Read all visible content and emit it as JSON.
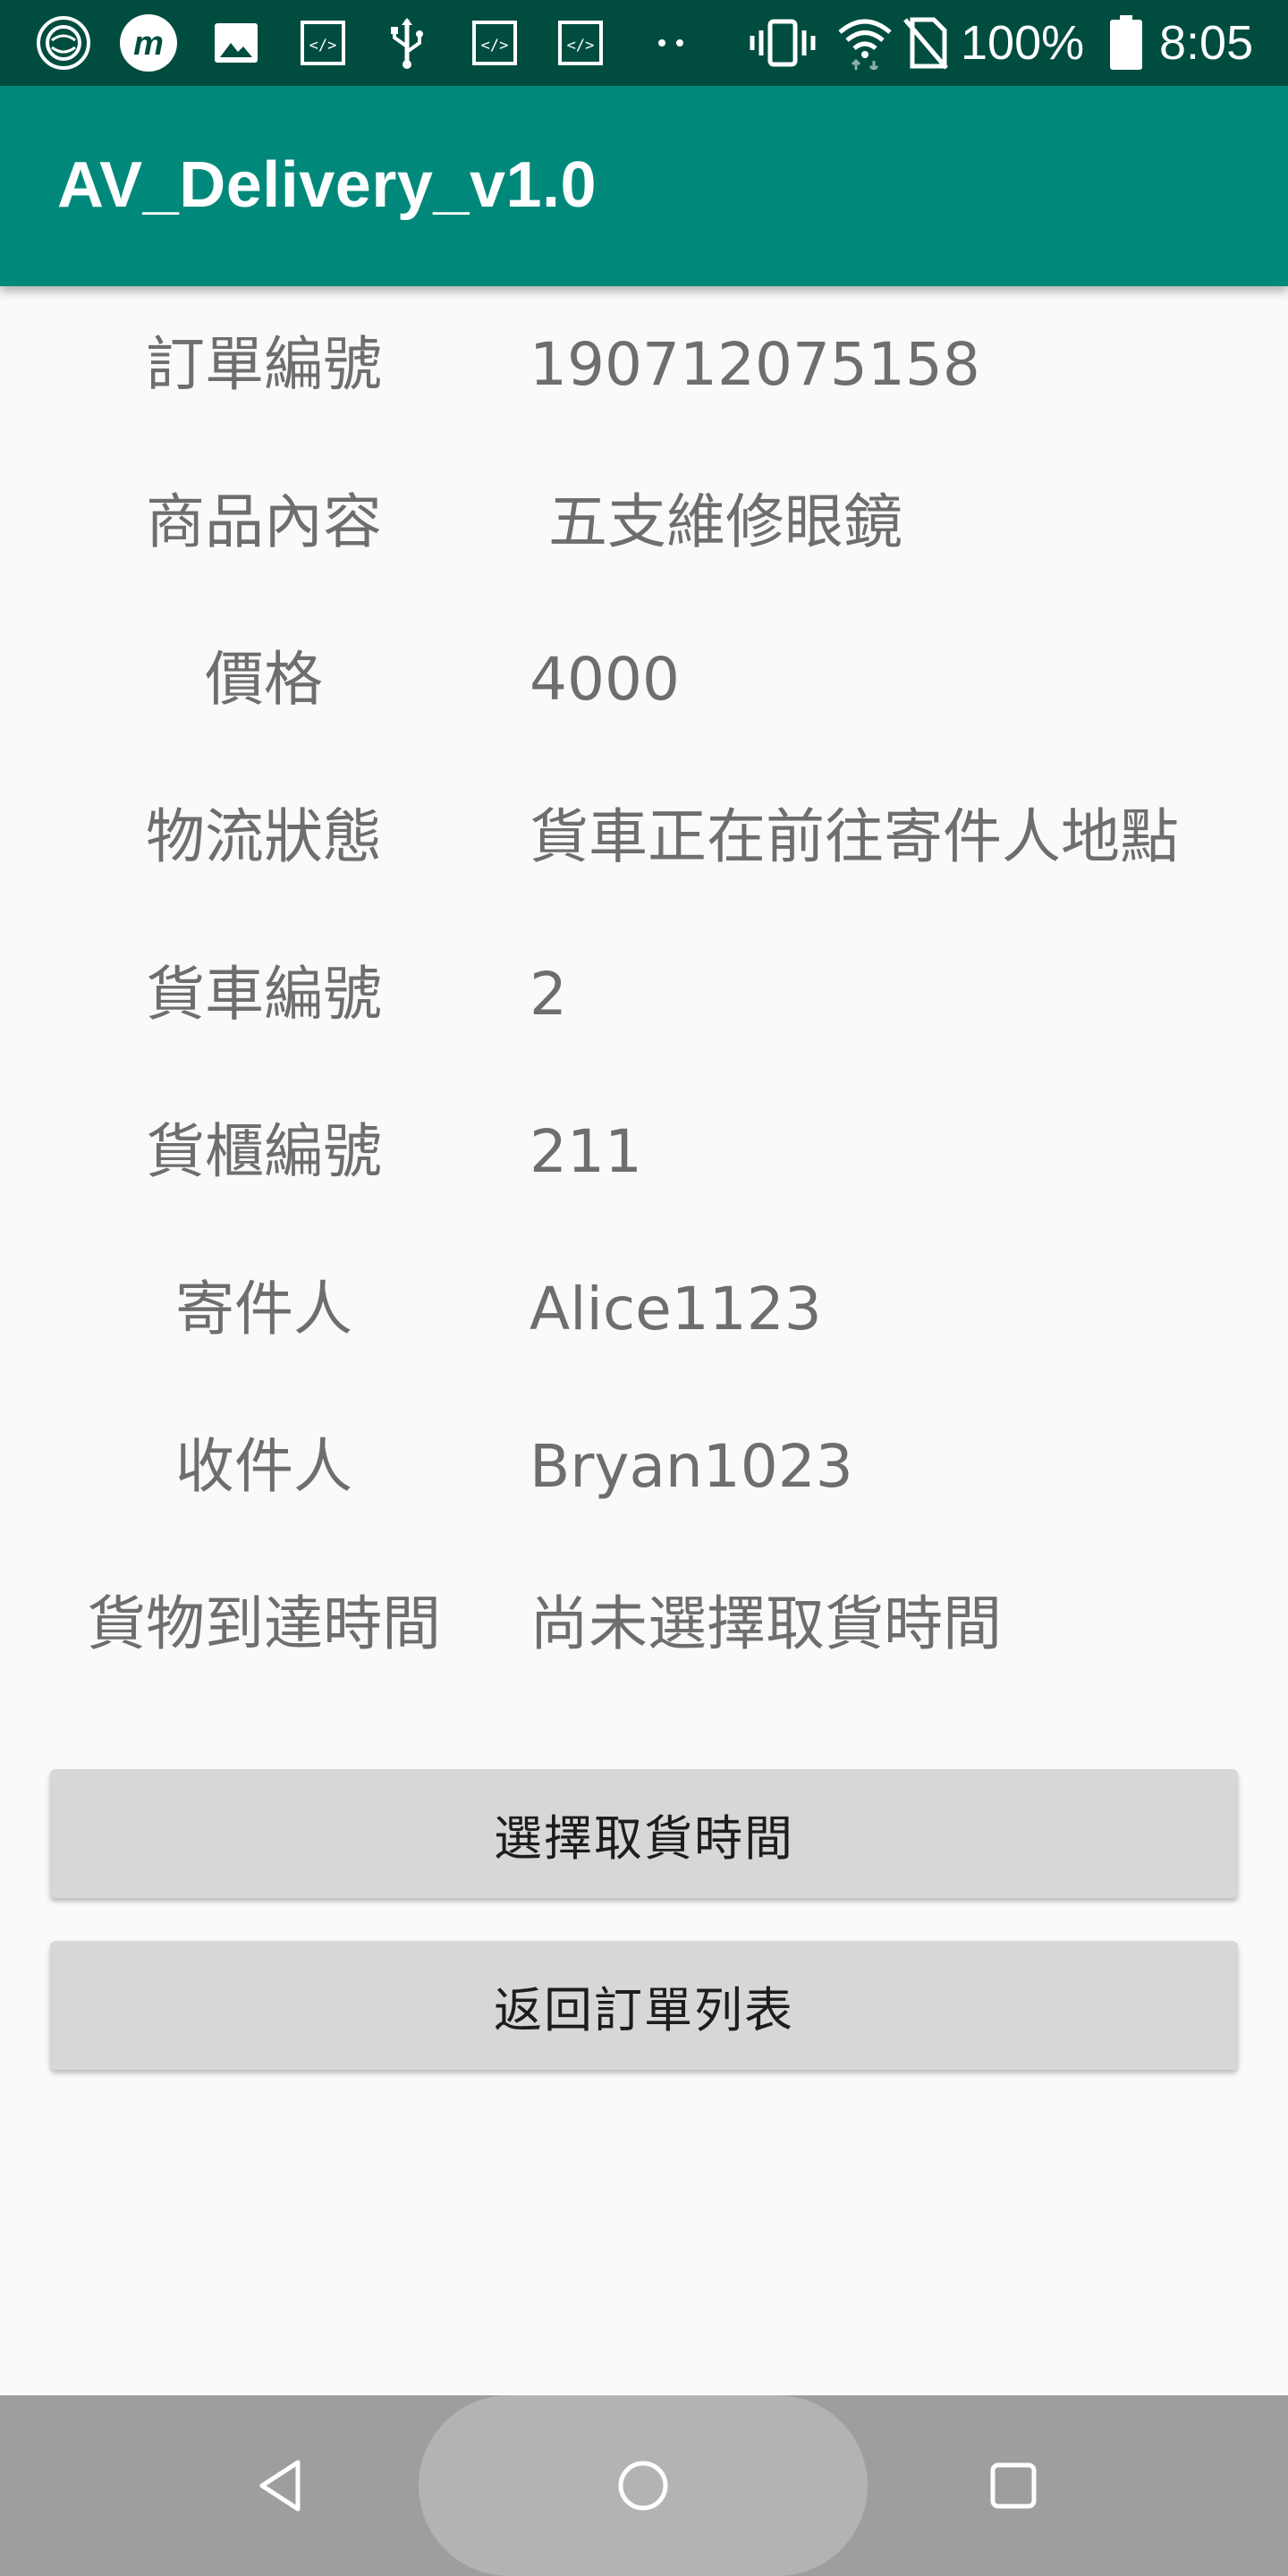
{
  "status_bar": {
    "battery": "100%",
    "time": "8:05",
    "icons": [
      "signal-ring-icon",
      "m-app-icon",
      "image-icon",
      "code-icon",
      "usb-icon",
      "code-icon",
      "code-icon",
      "more-dots-icon",
      "vibrate-icon",
      "wifi-icon",
      "no-sim-icon",
      "battery-icon"
    ]
  },
  "app_bar": {
    "title": "AV_Delivery_v1.0"
  },
  "details": {
    "rows": [
      {
        "label": "訂單編號",
        "value": "190712075158"
      },
      {
        "label": "商品內容",
        "value": " 五支維修眼鏡"
      },
      {
        "label": "價格",
        "value": "4000"
      },
      {
        "label": "物流狀態",
        "value": "貨車正在前往寄件人地點"
      },
      {
        "label": "貨車編號",
        "value": "2"
      },
      {
        "label": "貨櫃編號",
        "value": "211"
      },
      {
        "label": "寄件人",
        "value": "Alice1123"
      },
      {
        "label": "收件人",
        "value": "Bryan1023"
      },
      {
        "label": "貨物到達時間",
        "value": "尚未選擇取貨時間"
      }
    ]
  },
  "buttons": {
    "choose_pickup_time": "選擇取貨時間",
    "back_to_orders": "返回訂單列表"
  },
  "nav_bar": {
    "icons": [
      "back-icon",
      "home-icon",
      "recents-icon"
    ]
  },
  "colors": {
    "status_bar": "#004d40",
    "app_bar": "#00897b",
    "background": "#fafafa",
    "button": "#d6d7d7",
    "nav_bar": "#9e9e9e"
  }
}
